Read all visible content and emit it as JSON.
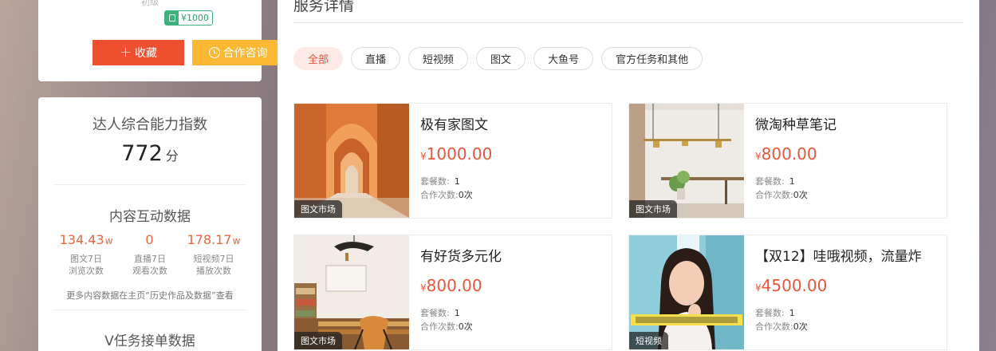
{
  "profile": {
    "level": "初级",
    "price_tag": "¥1000",
    "fav_label": "收藏",
    "consult_label": "合作咨询"
  },
  "ability": {
    "title": "达人综合能力指数",
    "score": "772",
    "unit": "分",
    "interaction_title": "内容互动数据",
    "metrics": [
      {
        "value": "134.43",
        "unit": "w",
        "line1": "图文7日",
        "line2": "浏览次数"
      },
      {
        "value": "0",
        "unit": "",
        "line1": "直播7日",
        "line2": "观看次数"
      },
      {
        "value": "178.17",
        "unit": "w",
        "line1": "短视频7日",
        "line2": "播放次数"
      }
    ],
    "note": "更多内容数据在主页“历史作品及数据”查看",
    "v_task_title": "V任务接单数据"
  },
  "services": {
    "title": "服务详情",
    "tabs": [
      "全部",
      "直播",
      "短视频",
      "图文",
      "大鱼号",
      "官方任务和其他"
    ],
    "active_tab": "全部",
    "currency": "¥",
    "count_label": "套餐数:",
    "coop_label": "合作次数:",
    "items": [
      {
        "name": "极有家图文",
        "price": "1000.00",
        "packages": "1",
        "coop": "0次",
        "badge": "图文市场"
      },
      {
        "name": "微淘种草笔记",
        "price": "800.00",
        "packages": "1",
        "coop": "0次",
        "badge": "图文市场"
      },
      {
        "name": "有好货多元化",
        "price": "800.00",
        "packages": "1",
        "coop": "0次",
        "badge": "图文市场"
      },
      {
        "name": "【双12】哇哦视频，流量炸",
        "price": "4500.00",
        "packages": "1",
        "coop": "0次",
        "badge": "短视频"
      }
    ]
  }
}
